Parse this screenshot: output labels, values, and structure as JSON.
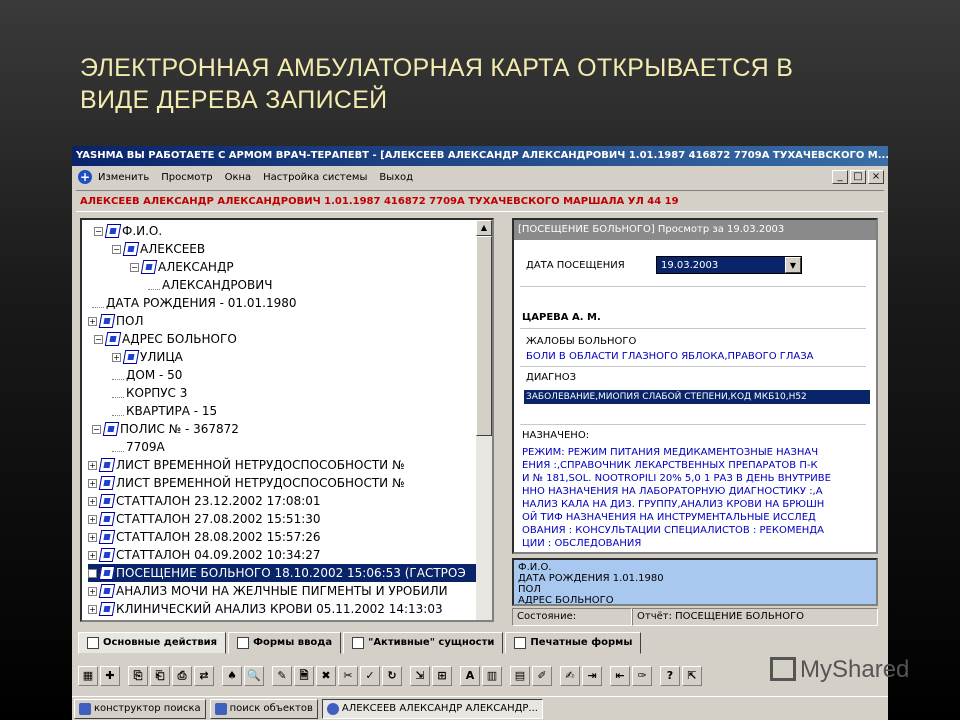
{
  "slide": {
    "title_line1": "ЭЛЕКТРОННАЯ АМБУЛАТОРНАЯ КАРТА ОТКРЫВАЕТСЯ В",
    "title_line2": "ВИДЕ ДЕРЕВА ЗАПИСЕЙ"
  },
  "window": {
    "title": "YASHMA   ВЫ РАБОТАЕТЕ С АРМОМ ВРАЧ-ТЕРАПЕВТ - [АЛЕКСЕЕВ АЛЕКСАНДР АЛЕКСАНДРОВИЧ 1.01.1987 416872 7709А ТУХАЧЕВСКОГО М...",
    "controls": [
      "_",
      "□",
      "×"
    ]
  },
  "menu": [
    "Изменить",
    "Просмотр",
    "Окна",
    "Настройка системы",
    "Выход"
  ],
  "patient_line": "АЛЕКСЕЕВ АЛЕКСАНДР АЛЕКСАНДРОВИЧ 1.01.1987 416872 7709А ТУХАЧЕВСКОГО МАРШАЛА УЛ 44 19",
  "tree": [
    {
      "text": "Ф.И.О.",
      "exp": "⊟",
      "icon": true
    },
    {
      "text": "АЛЕКСЕЕВ",
      "exp": "⊟",
      "icon": true
    },
    {
      "text": "АЛЕКСАНДР",
      "exp": "⊟",
      "icon": true
    },
    {
      "text": "АЛЕКСАНДРОВИЧ",
      "exp": "",
      "icon": false
    },
    {
      "text": "ДАТА РОЖДЕНИЯ - 01.01.1980",
      "exp": "",
      "icon": false
    },
    {
      "text": "ПОЛ",
      "exp": "⊞",
      "icon": true
    },
    {
      "text": "АДРЕС БОЛЬНОГО",
      "exp": "⊟",
      "icon": true
    },
    {
      "text": "УЛИЦА",
      "exp": "⊞",
      "icon": true
    },
    {
      "text": "ДОМ - 50",
      "exp": "",
      "icon": false
    },
    {
      "text": "КОРПУС 3",
      "exp": "",
      "icon": false
    },
    {
      "text": "КВАРТИРА - 15",
      "exp": "",
      "icon": false
    },
    {
      "text": "ПОЛИС № - 367872",
      "exp": "⊟",
      "icon": true
    },
    {
      "text": "7709А",
      "exp": "",
      "icon": false
    },
    {
      "text": "ЛИСТ ВРЕМЕННОЙ НЕТРУДОСПОСОБНОСТИ №",
      "exp": "⊞",
      "icon": true
    },
    {
      "text": "ЛИСТ ВРЕМЕННОЙ НЕТРУДОСПОСОБНОСТИ №",
      "exp": "⊞",
      "icon": true
    },
    {
      "text": "СТАТТАЛОН 23.12.2002 17:08:01",
      "exp": "⊞",
      "icon": true
    },
    {
      "text": "СТАТТАЛОН 27.08.2002 15:51:30",
      "exp": "⊞",
      "icon": true
    },
    {
      "text": "СТАТТАЛОН 28.08.2002 15:57:26",
      "exp": "⊞",
      "icon": true
    },
    {
      "text": "СТАТТАЛОН 04.09.2002 10:34:27",
      "exp": "⊞",
      "icon": true
    },
    {
      "text": "ПОСЕЩЕНИЕ БОЛЬНОГО 18.10.2002 15:06:53  (ГАСТРОЭ",
      "exp": "⊞",
      "icon": true,
      "selected": true
    },
    {
      "text": "АНАЛИЗ МОЧИ НА ЖЕЛЧНЫЕ ПИГМЕНТЫ И УРОБИЛИ",
      "exp": "⊞",
      "icon": true
    },
    {
      "text": "КЛИНИЧЕСКИЙ АНАЛИЗ КРОВИ 05.11.2002 14:13:03",
      "exp": "⊞",
      "icon": true
    }
  ],
  "panel": {
    "header": "[ПОСЕЩЕНИЕ БОЛЬНОГО] Просмотр за  19.03.2003",
    "date_label": "ДАТА ПОСЕЩЕНИЯ",
    "date_value": "19.03.2003",
    "doctor": "ЦАРЕВА А. М.",
    "complaints_label": "ЖАЛОБЫ БОЛЬНОГО",
    "complaints_value": "БОЛИ В ОБЛАСТИ ГЛАЗНОГО ЯБЛОКА,ПРАВОГО ГЛАЗА",
    "diagnosis_label": "ДИАГНОЗ",
    "diagnosis_value": "ЗАБОЛЕВАНИЕ,МИОПИЯ СЛАБОЙ СТЕПЕНИ,КОД МКБ10,Н52",
    "prescribed_label": "НАЗНАЧЕНО:",
    "prescribed_lines": [
      "РЕЖИМ: РЕЖИМ ПИТАНИЯ МЕДИКАМЕНТОЗНЫЕ НАЗНАЧ",
      "ЕНИЯ :,СПРАВОЧНИК ЛЕКАРСТВЕННЫХ ПРЕПАРАТОВ П-К",
      "И № 181,SOL. NOOTROPILI 20% 5,0 1 РАЗ В ДЕНЬ ВНУТРИВЕ",
      "ННО НАЗНАЧЕНИЯ НА ЛАБОРАТОРНУЮ ДИАГНОСТИКУ :,А",
      "НАЛИЗ КАЛА НА ДИЗ. ГРУППУ,АНАЛИЗ КРОВИ НА БРЮШН",
      "ОЙ ТИФ НАЗНАЧЕНИЯ НА ИНСТРУМЕНТАЛЬНЫЕ ИССЛЕД",
      "ОВАНИЯ : КОНСУЛЬТАЦИИ СПЕЦИАЛИСТОВ : РЕКОМЕНДА",
      "ЦИИ : ОБСЛЕДОВАНИЯ"
    ]
  },
  "preview_lines": [
    "Ф.И.О.",
    "ДАТА РОЖДЕНИЯ 1.01.1980",
    "ПОЛ",
    "АДРЕС БОЛЬНОГО"
  ],
  "status": {
    "state_label": "Состояние:",
    "report_label": "Отчёт: ПОСЕЩЕНИЕ БОЛЬНОГО"
  },
  "tabs": [
    "Основные действия",
    "Формы ввода",
    "\"Активные\" сущности",
    "Печатные формы"
  ],
  "toolbar_icons": [
    "grid-icon",
    "flag-icon",
    "copy-icon",
    "paste-icon",
    "print-icon",
    "arrows-icon",
    "binoculars-icon",
    "zoom-icon",
    "edit-icon",
    "search-doc-icon",
    "delete-icon",
    "cut-icon",
    "mark-icon",
    "refresh-icon",
    "chart-icon",
    "table-icon",
    "text-A-icon",
    "color-grid-icon",
    "list-icon",
    "pen-icon",
    "note-icon",
    "export-icon",
    "import-icon",
    "brush-icon",
    "help-icon",
    "exit-icon"
  ],
  "toolbar_glyphs": [
    "▦",
    "✚",
    "⎘",
    "⎗",
    "⎙",
    "⇄",
    "♠",
    "🔍",
    "✎",
    "🗎",
    "✖",
    "✂",
    "✓",
    "↻",
    "⇲",
    "⊞",
    "A",
    "▥",
    "▤",
    "✐",
    "✍",
    "⇥",
    "⇤",
    "✑",
    "?",
    "⇱"
  ],
  "taskbar": [
    "конструктор поиска",
    "поиск объектов",
    "АЛЕКСЕЕВ АЛЕКСАНДР АЛЕКСАНДР..."
  ],
  "watermark": "MyShared"
}
